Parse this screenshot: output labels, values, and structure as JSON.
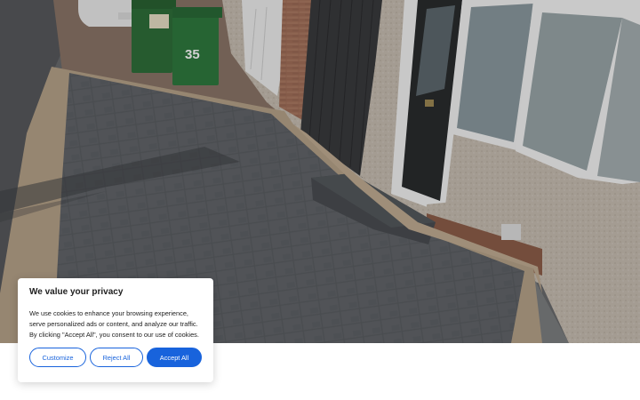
{
  "hero": {
    "alt": "Grey block paved driveway with buff border in front of a terraced house",
    "bin_number": "35"
  },
  "cookie_banner": {
    "title": "We value your privacy",
    "text": "We use cookies to enhance your browsing experience, serve personalized ads or content, and analyze our traffic. By clicking \"Accept All\", you consent to our use of cookies.",
    "customize_label": "Customize",
    "reject_label": "Reject All",
    "accept_label": "Accept All"
  },
  "colors": {
    "accent": "#1863dc",
    "text": "#212121",
    "paving": "#55585c",
    "border_paving": "#b8a48a"
  }
}
